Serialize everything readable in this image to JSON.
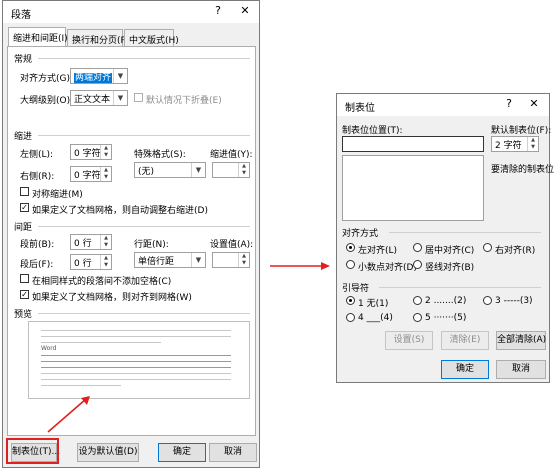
{
  "para": {
    "title": "段落",
    "help": "?",
    "close": "✕",
    "tabs": [
      "缩进和间距(I)",
      "换行和分页(P)",
      "中文版式(H)"
    ],
    "general": {
      "heading": "常规",
      "align_label": "对齐方式(G):",
      "align_value": "两端对齐",
      "outline_label": "大纲级别(O):",
      "outline_value": "正文文本",
      "collapse_label": "默认情况下折叠(E)"
    },
    "indent": {
      "heading": "缩进",
      "left_label": "左侧(L):",
      "left_value": "0 字符",
      "right_label": "右侧(R):",
      "right_value": "0 字符",
      "special_label": "特殊格式(S):",
      "special_value": "(无)",
      "amount_label": "缩进值(Y):",
      "mirror_label": "对称缩进(M)",
      "grid_label": "如果定义了文档网格，则自动调整右缩进(D)"
    },
    "spacing": {
      "heading": "间距",
      "before_label": "段前(B):",
      "before_value": "0 行",
      "after_label": "段后(F):",
      "after_value": "0 行",
      "line_label": "行距(N):",
      "line_value": "单倍行距",
      "at_label": "设置值(A):",
      "nospace_label": "在相同样式的段落间不添加空格(C)",
      "snap_label": "如果定义了文档网格，则对齐到网格(W)"
    },
    "preview": {
      "heading": "预览",
      "word": "Word"
    },
    "buttons": {
      "tabs": "制表位(T)...",
      "default": "设为默认值(D)",
      "ok": "确定",
      "cancel": "取消"
    }
  },
  "tabs_dialog": {
    "title": "制表位",
    "help": "?",
    "close": "✕",
    "stop_label": "制表位位置(T):",
    "stop_value": "",
    "default_label": "默认制表位(F):",
    "default_value": "2 字符",
    "clear_label": "要清除的制表位:",
    "alignment": {
      "heading": "对齐方式",
      "options": [
        "左对齐(L)",
        "居中对齐(C)",
        "右对齐(R)",
        "小数点对齐(D)",
        "竖线对齐(B)"
      ],
      "selected": "左对齐(L)"
    },
    "leader": {
      "heading": "引导符",
      "options": [
        "1 无(1)",
        "2 .......(2)",
        "3 -----(3)",
        "4 ___(4)",
        "5 ·······(5)"
      ],
      "selected": "1 无(1)"
    },
    "buttons": {
      "set": "设置(S)",
      "clear": "清除(E)",
      "clear_all": "全部清除(A)",
      "ok": "确定",
      "cancel": "取消"
    }
  },
  "colors": {
    "highlight": "#e02020",
    "selection": "#0078d7"
  }
}
